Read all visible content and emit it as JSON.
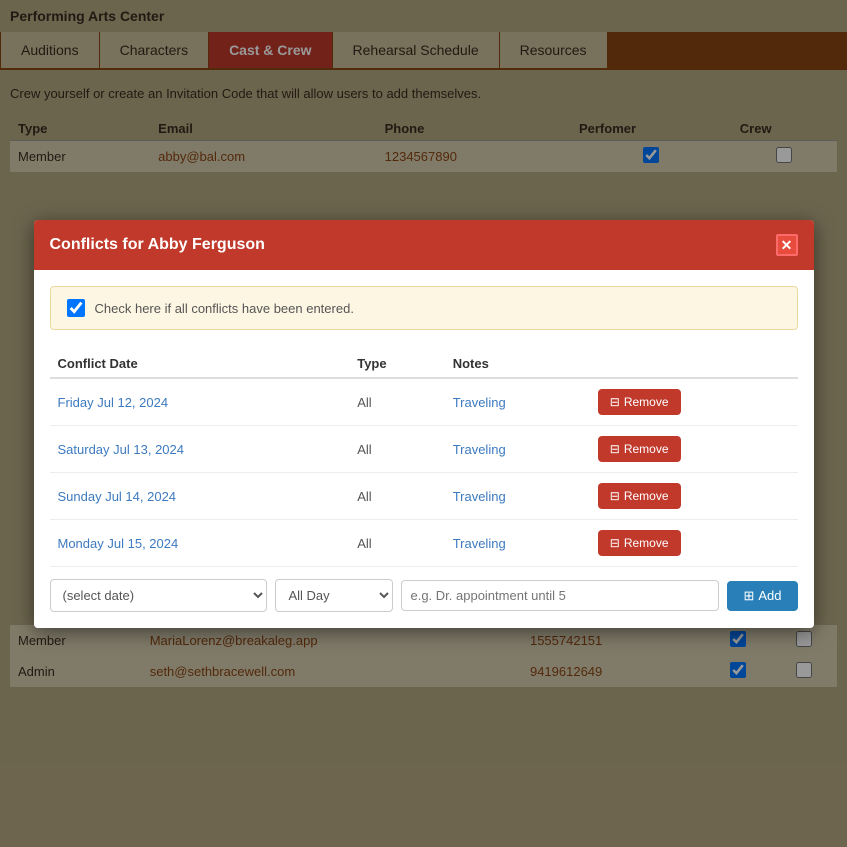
{
  "app": {
    "org_name": "Performing Arts Center"
  },
  "tabs": [
    {
      "id": "auditions",
      "label": "Auditions",
      "active": false
    },
    {
      "id": "characters",
      "label": "Characters",
      "active": false
    },
    {
      "id": "cast-crew",
      "label": "Cast & Crew",
      "active": true
    },
    {
      "id": "rehearsal-schedule",
      "label": "Rehearsal Schedule",
      "active": false
    },
    {
      "id": "resources",
      "label": "Resources",
      "active": false
    }
  ],
  "page": {
    "subtitle": "Crew yourself or create an Invitation Code that will allow users to add themselves."
  },
  "crew_table": {
    "columns": [
      "Type",
      "Email",
      "Phone",
      "Perfomer",
      "Crew"
    ],
    "rows": [
      {
        "type": "Member",
        "email": "abby@bal.com",
        "phone": "1234567890",
        "performer": true,
        "crew": false
      }
    ]
  },
  "modal": {
    "title": "Conflicts for Abby Ferguson",
    "notice": {
      "label": "Check here if all conflicts have been entered.",
      "checked": true
    },
    "columns": [
      "Conflict Date",
      "Type",
      "Notes"
    ],
    "conflicts": [
      {
        "date_text": "Friday ",
        "date_highlight": "Jul 12, 2024",
        "type": "All",
        "notes": "Traveling"
      },
      {
        "date_text": "Saturday ",
        "date_highlight": "Jul 13, 2024",
        "type": "All",
        "notes": "Traveling"
      },
      {
        "date_text": "Sunday ",
        "date_highlight": "Jul 14, 2024",
        "type": "All",
        "notes": "Traveling"
      },
      {
        "date_text": "Monday ",
        "date_highlight": "Jul 15, 2024",
        "type": "All",
        "notes": "Traveling"
      }
    ],
    "remove_label": "Remove",
    "add_row": {
      "date_placeholder": "(select date)",
      "type_default": "All Day",
      "notes_placeholder": "e.g. Dr. appointment until 5",
      "add_label": "Add"
    }
  },
  "behind_rows": [
    {
      "type": "Member",
      "email": "MariaLorenz@breakaleg.app",
      "phone": "1555742151",
      "performer": true,
      "crew": false
    },
    {
      "type": "Admin",
      "email": "seth@sethbracewell.com",
      "phone": "9419612649",
      "performer": true,
      "crew": false
    }
  ],
  "icons": {
    "close": "✕",
    "remove": "⊟",
    "add": "⊞"
  }
}
